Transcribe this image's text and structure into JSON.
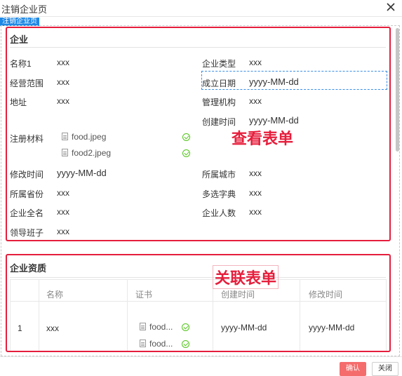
{
  "window": {
    "title": "注销企业页",
    "tag": "注销企业页"
  },
  "form": {
    "section_title": "企业",
    "annotation": "查看表单",
    "fields": {
      "name": {
        "label": "名称1",
        "value": "xxx"
      },
      "type": {
        "label": "企业类型",
        "value": "xxx"
      },
      "scope": {
        "label": "经营范围",
        "value": "xxx"
      },
      "founded": {
        "label": "成立日期",
        "value": "yyyy-MM-dd"
      },
      "address": {
        "label": "地址",
        "value": "xxx"
      },
      "authority": {
        "label": "管理机构",
        "value": "xxx"
      },
      "created": {
        "label": "创建时间",
        "value": "yyyy-MM-dd"
      },
      "materials": {
        "label": "注册材料",
        "files": [
          "food.jpeg",
          "food2.jpeg"
        ]
      },
      "modified": {
        "label": "修改时间",
        "value": "yyyy-MM-dd"
      },
      "city": {
        "label": "所属城市",
        "value": "xxx"
      },
      "province": {
        "label": "所属省份",
        "value": "xxx"
      },
      "dict": {
        "label": "多选字典",
        "value": "xxx"
      },
      "fullname": {
        "label": "企业全名",
        "value": "xxx"
      },
      "headcount": {
        "label": "企业人数",
        "value": "xxx"
      },
      "leaders": {
        "label": "领导班子",
        "value": "xxx"
      }
    }
  },
  "related": {
    "section_title": "企业资质",
    "annotation": "关联表单",
    "columns": [
      "名称",
      "证书",
      "创建时间",
      "修改时间"
    ],
    "rows": [
      {
        "index": "1",
        "name": "xxx",
        "certs": [
          "food...",
          "food..."
        ],
        "created": "yyyy-MM-dd",
        "modified": "yyyy-MM-dd"
      }
    ]
  },
  "footer": {
    "confirm_label": "确认",
    "close_label": "关闭"
  },
  "colors": {
    "annotation": "#e61e3c",
    "confirm": "#f56c6c",
    "tag": "#1e88e5",
    "success": "#52c41a"
  }
}
